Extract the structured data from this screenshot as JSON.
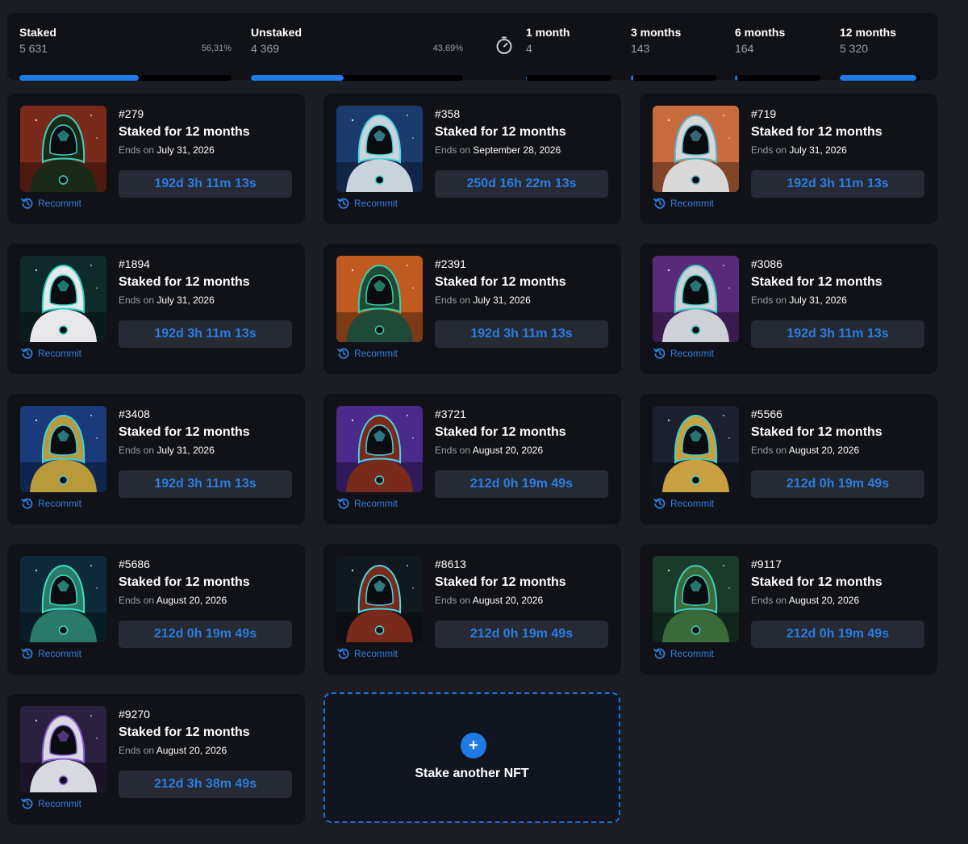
{
  "colors": {
    "accent": "#1f7be3",
    "panel": "#111217",
    "background": "#1b1d24",
    "countdown_bg": "#262a34"
  },
  "stats": {
    "staked": {
      "label": "Staked",
      "value": "5 631",
      "percent_text": "56,31%",
      "progress": 0.5631
    },
    "unstaked": {
      "label": "Unstaked",
      "value": "4 369",
      "percent_text": "43,69%",
      "progress": 0.4369
    },
    "timer_icon": "stopwatch-icon",
    "durations": [
      {
        "label": "1 month",
        "value": "4",
        "progress": 0.0008
      },
      {
        "label": "3 months",
        "value": "143",
        "progress": 0.027
      },
      {
        "label": "6 months",
        "value": "164",
        "progress": 0.031
      },
      {
        "label": "12 months",
        "value": "5 320",
        "progress": 0.945
      }
    ]
  },
  "cards": [
    {
      "id": "#279",
      "title": "Staked for 12 months",
      "ends_prefix": "Ends on",
      "ends_date": "July 31, 2026",
      "countdown": "192d 3h 11m 13s",
      "recommit": "Recommit",
      "palette": [
        "#7a2a1a",
        "#1a2a18",
        "#3ad1c2"
      ]
    },
    {
      "id": "#358",
      "title": "Staked for 12 months",
      "ends_prefix": "Ends on",
      "ends_date": "September 28, 2026",
      "countdown": "250d 16h 22m 13s",
      "recommit": "Recommit",
      "palette": [
        "#1b3b6e",
        "#c9d3dc",
        "#4fd6e0"
      ]
    },
    {
      "id": "#719",
      "title": "Staked for 12 months",
      "ends_prefix": "Ends on",
      "ends_date": "July 31, 2026",
      "countdown": "192d 3h 11m 13s",
      "recommit": "Recommit",
      "palette": [
        "#c86a3c",
        "#d8d8d8",
        "#5fb0c8"
      ]
    },
    {
      "id": "#1894",
      "title": "Staked for 12 months",
      "ends_prefix": "Ends on",
      "ends_date": "July 31, 2026",
      "countdown": "192d 3h 11m 13s",
      "recommit": "Recommit",
      "palette": [
        "#0f2a2a",
        "#e8e8ea",
        "#2fd3c2"
      ]
    },
    {
      "id": "#2391",
      "title": "Staked for 12 months",
      "ends_prefix": "Ends on",
      "ends_date": "July 31, 2026",
      "countdown": "192d 3h 11m 13s",
      "recommit": "Recommit",
      "palette": [
        "#c05a20",
        "#1f4a3a",
        "#3ad1a2"
      ]
    },
    {
      "id": "#3086",
      "title": "Staked for 12 months",
      "ends_prefix": "Ends on",
      "ends_date": "July 31, 2026",
      "countdown": "192d 3h 11m 13s",
      "recommit": "Recommit",
      "palette": [
        "#5a2a7a",
        "#d0d0d8",
        "#3fd0c8"
      ]
    },
    {
      "id": "#3408",
      "title": "Staked for 12 months",
      "ends_prefix": "Ends on",
      "ends_date": "July 31, 2026",
      "countdown": "192d 3h 11m 13s",
      "recommit": "Recommit",
      "palette": [
        "#1a3a7a",
        "#b89a3a",
        "#3fd0e0"
      ]
    },
    {
      "id": "#3721",
      "title": "Staked for 12 months",
      "ends_prefix": "Ends on",
      "ends_date": "August 20, 2026",
      "countdown": "212d 0h 19m 49s",
      "recommit": "Recommit",
      "palette": [
        "#4a2a8a",
        "#7a2a1a",
        "#4fd0e0"
      ]
    },
    {
      "id": "#5566",
      "title": "Staked for 12 months",
      "ends_prefix": "Ends on",
      "ends_date": "August 20, 2026",
      "countdown": "212d 0h 19m 49s",
      "recommit": "Recommit",
      "palette": [
        "#1a2030",
        "#c8a040",
        "#3fd0c8"
      ]
    },
    {
      "id": "#5686",
      "title": "Staked for 12 months",
      "ends_prefix": "Ends on",
      "ends_date": "August 20, 2026",
      "countdown": "212d 0h 19m 49s",
      "recommit": "Recommit",
      "palette": [
        "#0f2a3a",
        "#2a7a6a",
        "#3fe0c0"
      ]
    },
    {
      "id": "#8613",
      "title": "Staked for 12 months",
      "ends_prefix": "Ends on",
      "ends_date": "August 20, 2026",
      "countdown": "212d 0h 19m 49s",
      "recommit": "Recommit",
      "palette": [
        "#101820",
        "#7a2a1a",
        "#4fd6e0"
      ]
    },
    {
      "id": "#9117",
      "title": "Staked for 12 months",
      "ends_prefix": "Ends on",
      "ends_date": "August 20, 2026",
      "countdown": "212d 0h 19m 49s",
      "recommit": "Recommit",
      "palette": [
        "#1a3a2a",
        "#3a6a3a",
        "#3fd0c0"
      ]
    },
    {
      "id": "#9270",
      "title": "Staked for 12 months",
      "ends_prefix": "Ends on",
      "ends_date": "August 20, 2026",
      "countdown": "212d 3h 38m 49s",
      "recommit": "Recommit",
      "palette": [
        "#2a2040",
        "#d8d8e0",
        "#8a5ad0"
      ]
    }
  ],
  "add_card": {
    "label": "Stake another NFT",
    "icon": "plus-icon",
    "plus_glyph": "+"
  }
}
